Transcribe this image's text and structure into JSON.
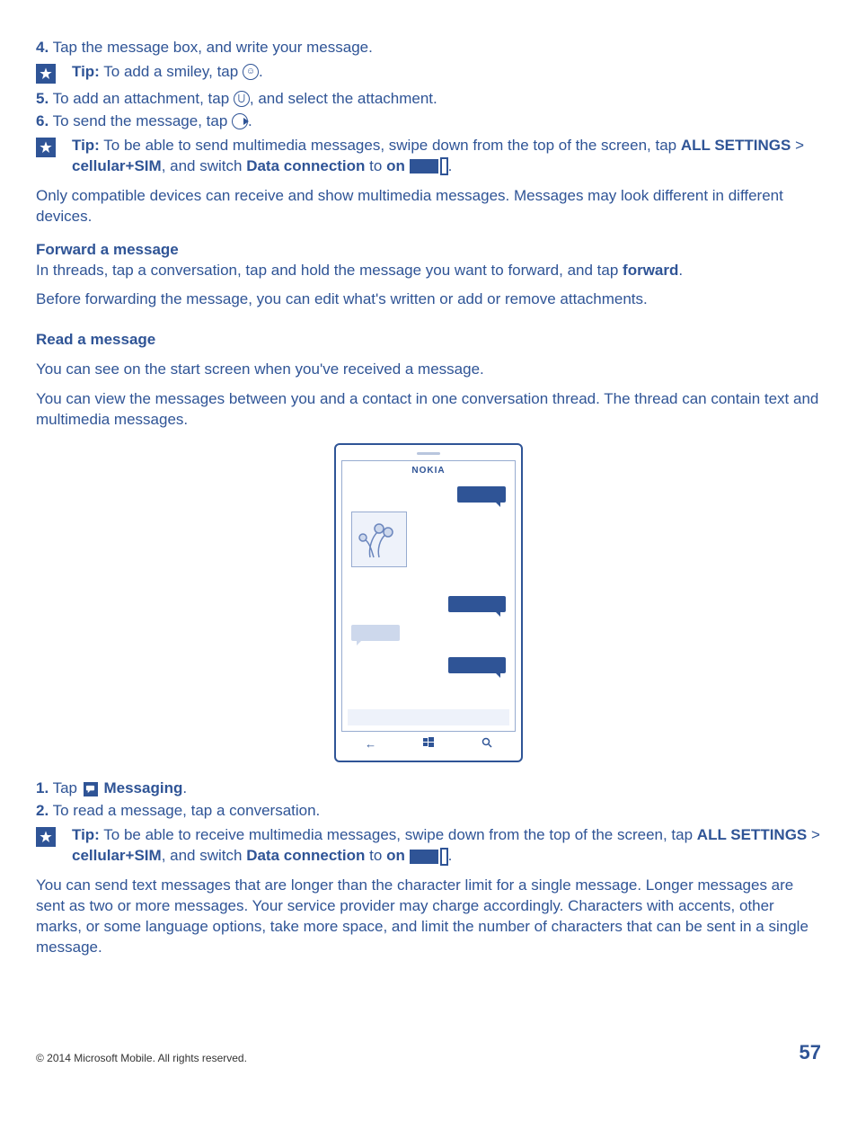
{
  "steps_a": {
    "s4": {
      "num": "4.",
      "text": " Tap the message box, and write your message."
    },
    "tip1": {
      "label": "Tip:",
      "text": " To add a smiley, tap ",
      "tail": "."
    },
    "s5": {
      "num": "5.",
      "pre": " To add an attachment, tap ",
      "post": ", and select the attachment."
    },
    "s6": {
      "num": "6.",
      "pre": " To send the message, tap ",
      "post": "."
    },
    "tip2": {
      "label": "Tip:",
      "t1": " To be able to send multimedia messages, swipe down from the top of the screen, tap ",
      "b1": "ALL SETTINGS",
      "sep1": " > ",
      "b2": "cellular+SIM",
      "t2": ", and switch ",
      "b3": "Data connection",
      "t3": " to ",
      "b4": "on",
      "tail": "."
    }
  },
  "para1": "Only compatible devices can receive and show multimedia messages. Messages may look different in different devices.",
  "fwd": {
    "h": "Forward a message",
    "p1a": "In threads, tap a conversation, tap and hold the message you want to forward, and tap ",
    "p1b": "forward",
    "p1c": ".",
    "p2": "Before forwarding the message, you can edit what's written or add or remove attachments."
  },
  "read": {
    "h": "Read a message",
    "p1": "You can see on the start screen when you've received a message.",
    "p2": "You can view the messages between you and a contact in one conversation thread. The thread can contain text and multimedia messages."
  },
  "phone_brand": "NOKIA",
  "steps_b": {
    "s1": {
      "num": "1.",
      "pre": " Tap ",
      "b": "Messaging",
      "post": "."
    },
    "s2": {
      "num": "2.",
      "text": " To read a message, tap a conversation."
    },
    "tip3": {
      "label": "Tip:",
      "t1": " To be able to receive multimedia messages, swipe down from the top of the screen, tap ",
      "b1": "ALL SETTINGS",
      "sep1": " > ",
      "b2": "cellular+SIM",
      "t2": ", and switch ",
      "b3": "Data connection",
      "t3": " to ",
      "b4": "on",
      "tail": "."
    }
  },
  "para_long": "You can send text messages that are longer than the character limit for a single message. Longer messages are sent as two or more messages. Your service provider may charge accordingly. Characters with accents, other marks, or some language options, take more space, and limit the number of characters that can be sent in a single message.",
  "footer": {
    "copy": "© 2014 Microsoft Mobile. All rights reserved.",
    "page": "57"
  }
}
